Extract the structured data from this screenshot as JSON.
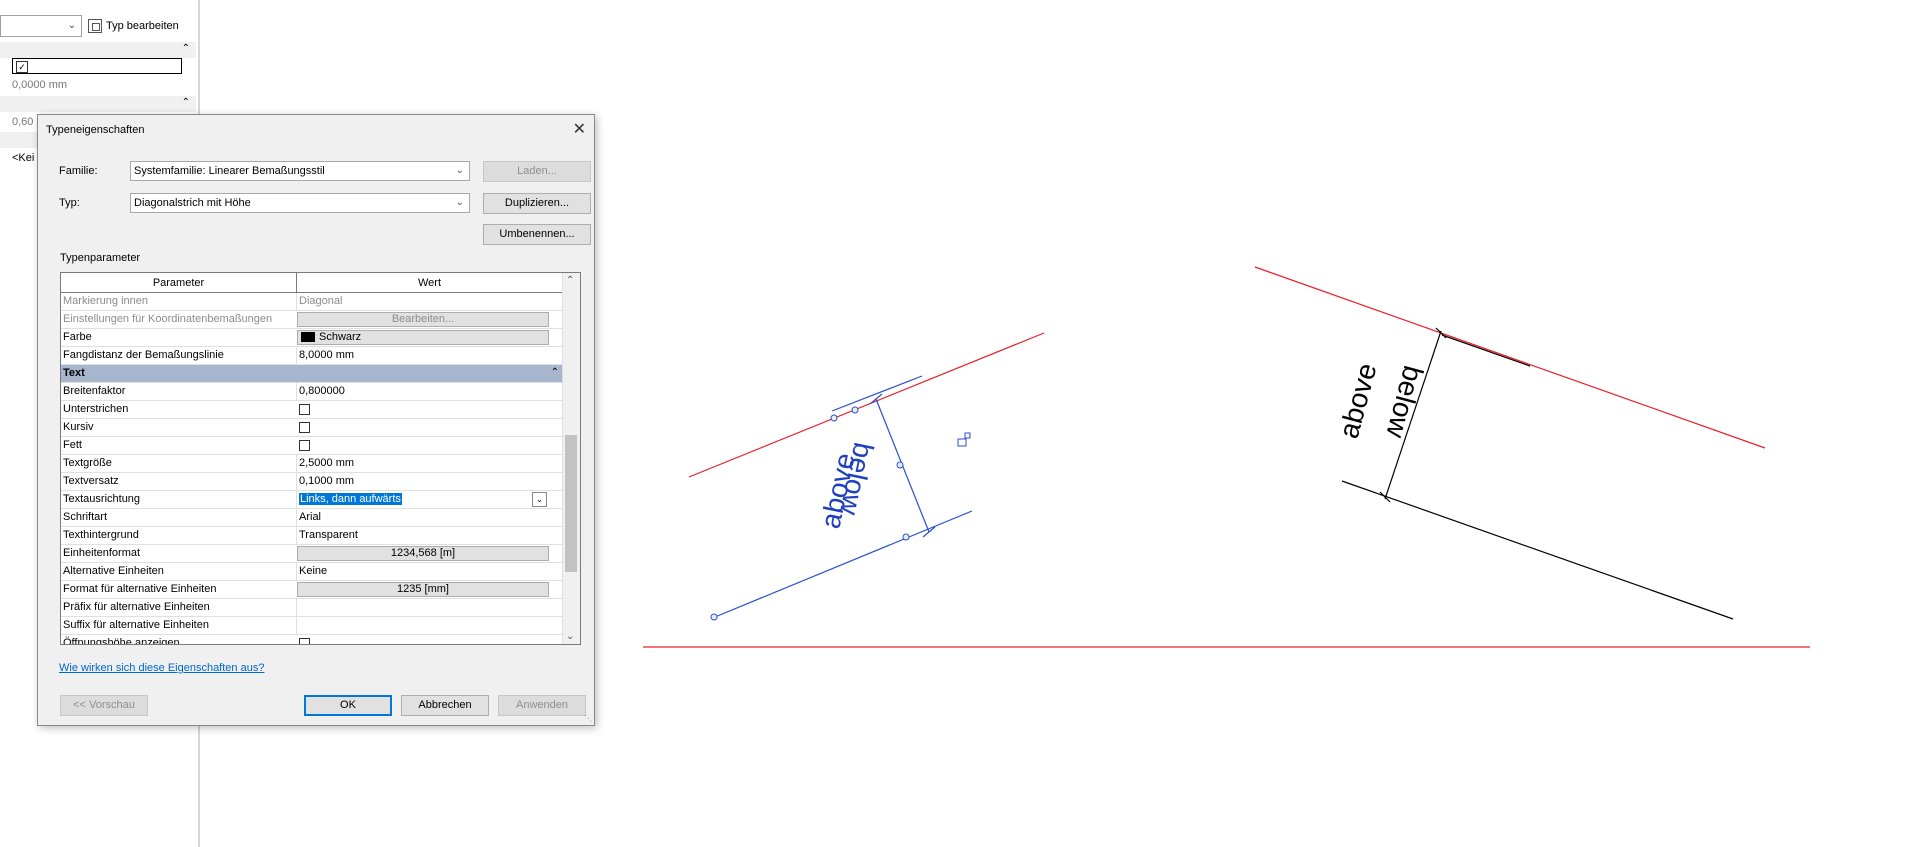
{
  "props": {
    "type_button": "Typ bearbeiten",
    "row_value1": "0,0000 mm",
    "row_value2": "0,60",
    "row_value3": "<Kei"
  },
  "dialog": {
    "title": "Typeneigenschaften",
    "family_label": "Familie:",
    "family_value": "Systemfamilie: Linearer Bemaßungsstil",
    "type_label": "Typ:",
    "type_value": "Diagonalstrich mit Höhe",
    "load_button": "Laden...",
    "duplicate_button": "Duplizieren...",
    "rename_button": "Umbenennen...",
    "section_label": "Typenparameter",
    "col_parameter": "Parameter",
    "col_value": "Wert",
    "col_eq": "=",
    "rows": [
      {
        "param": "Markierung innen",
        "value": "Diagonal"
      },
      {
        "param": "Einstellungen für Koordinatenbemaßungen",
        "value": "Bearbeiten..."
      },
      {
        "param": "Farbe",
        "value": "Schwarz"
      },
      {
        "param": "Fangdistanz der Bemaßungslinie",
        "value": "8,0000 mm"
      },
      {
        "param": "Text",
        "value": ""
      },
      {
        "param": "Breitenfaktor",
        "value": "0,800000"
      },
      {
        "param": "Unterstrichen",
        "value": ""
      },
      {
        "param": "Kursiv",
        "value": ""
      },
      {
        "param": "Fett",
        "value": ""
      },
      {
        "param": "Textgröße",
        "value": "2,5000 mm"
      },
      {
        "param": "Textversatz",
        "value": "0,1000 mm"
      },
      {
        "param": "Textausrichtung",
        "value": "Links, dann aufwärts"
      },
      {
        "param": "Schriftart",
        "value": "Arial"
      },
      {
        "param": "Texthintergrund",
        "value": "Transparent"
      },
      {
        "param": "Einheitenformat",
        "value": "1234,568 [m]"
      },
      {
        "param": "Alternative Einheiten",
        "value": "Keine"
      },
      {
        "param": "Format für alternative Einheiten",
        "value": "1235 [mm]"
      },
      {
        "param": "Präfix für alternative Einheiten",
        "value": ""
      },
      {
        "param": "Suffix für alternative Einheiten",
        "value": ""
      },
      {
        "param": "Öffnungshöhe anzeigen",
        "value": ""
      }
    ],
    "help_link": "Wie wirken sich diese Eigenschaften aus?",
    "preview_button": "<< Vorschau",
    "ok_button": "OK",
    "cancel_button": "Abbrechen",
    "apply_button": "Anwenden"
  },
  "canvas": {
    "blue_dim": {
      "top": "above",
      "bottom": "below"
    },
    "black_dim": {
      "top": "above",
      "bottom": "below"
    },
    "colors": {
      "red": "#e8202a",
      "blue": "#2a4fd0",
      "black": "#000000"
    }
  }
}
